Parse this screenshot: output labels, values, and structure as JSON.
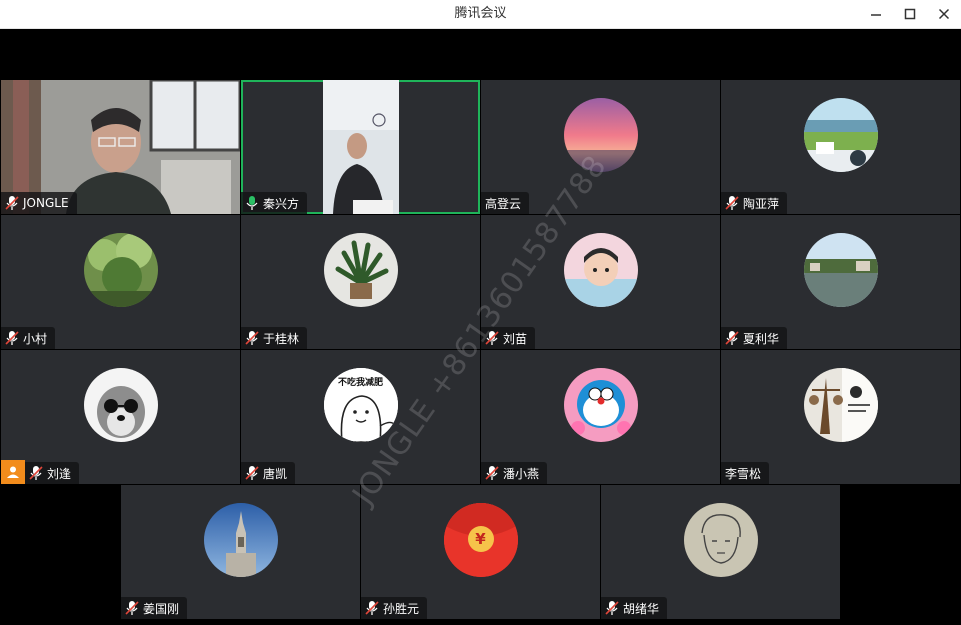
{
  "window": {
    "title": "腾讯会议"
  },
  "watermark": "JONGLE +8613601587788",
  "participants": [
    {
      "name": "JONGLE"
    },
    {
      "name": "秦兴方"
    },
    {
      "name": "高登云"
    },
    {
      "name": "陶亚萍"
    },
    {
      "name": "小村"
    },
    {
      "name": "于桂林"
    },
    {
      "name": "刘苗"
    },
    {
      "name": "夏利华"
    },
    {
      "name": "刘逢"
    },
    {
      "name": "唐凯"
    },
    {
      "name": "潘小燕"
    },
    {
      "name": "李雪松"
    },
    {
      "name": "姜国刚"
    },
    {
      "name": "孙胜元"
    },
    {
      "name": "胡绪华"
    }
  ],
  "avatar_text": {
    "tang_kai": "不吃我减肥",
    "sun_shengyuan": "¥"
  },
  "colors": {
    "tile_bg": "#2b2d31",
    "active_border": "#1fb45a",
    "host_badge": "#f28c1c",
    "mic_muted": "#e0463a"
  }
}
